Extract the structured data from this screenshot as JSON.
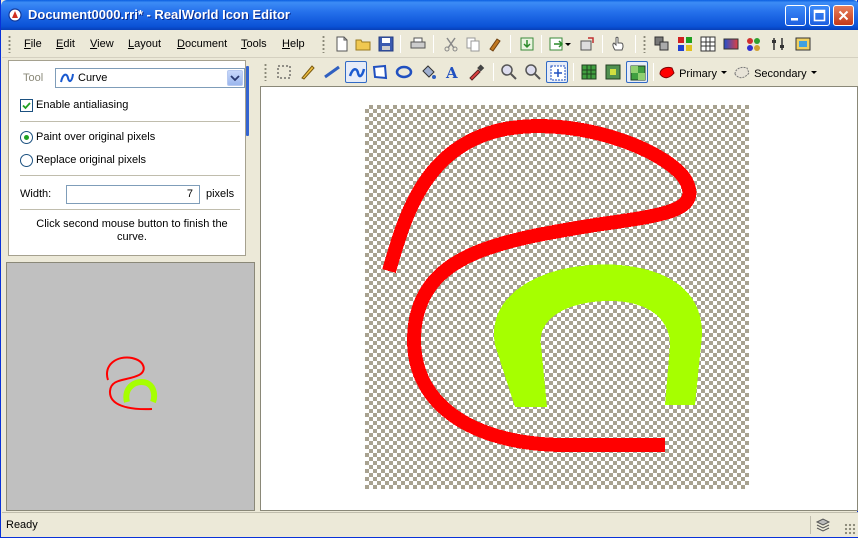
{
  "window": {
    "title": "Document0000.rri* - RealWorld Icon Editor"
  },
  "menu": [
    {
      "key": "F",
      "rest": "ile"
    },
    {
      "key": "E",
      "rest": "dit"
    },
    {
      "key": "V",
      "rest": "iew"
    },
    {
      "key": "L",
      "rest": "ayout"
    },
    {
      "key": "D",
      "rest": "ocument"
    },
    {
      "key": "T",
      "rest": "ools"
    },
    {
      "key": "H",
      "rest": "elp"
    }
  ],
  "tool_panel": {
    "tool_label": "Tool",
    "tool_value": "Curve",
    "antialias_label": "Enable antialiasing",
    "antialias_checked": true,
    "paint_over_label": "Paint over original pixels",
    "replace_label": "Replace original pixels",
    "width_label": "Width:",
    "width_value": "7",
    "width_unit": "pixels",
    "hint": "Click second mouse button to finish the curve."
  },
  "colors": {
    "primary_label": "Primary",
    "secondary_label": "Secondary",
    "primary_color": "#ff0000",
    "secondary_color": "#a6ff00"
  },
  "status": {
    "text": "Ready"
  }
}
